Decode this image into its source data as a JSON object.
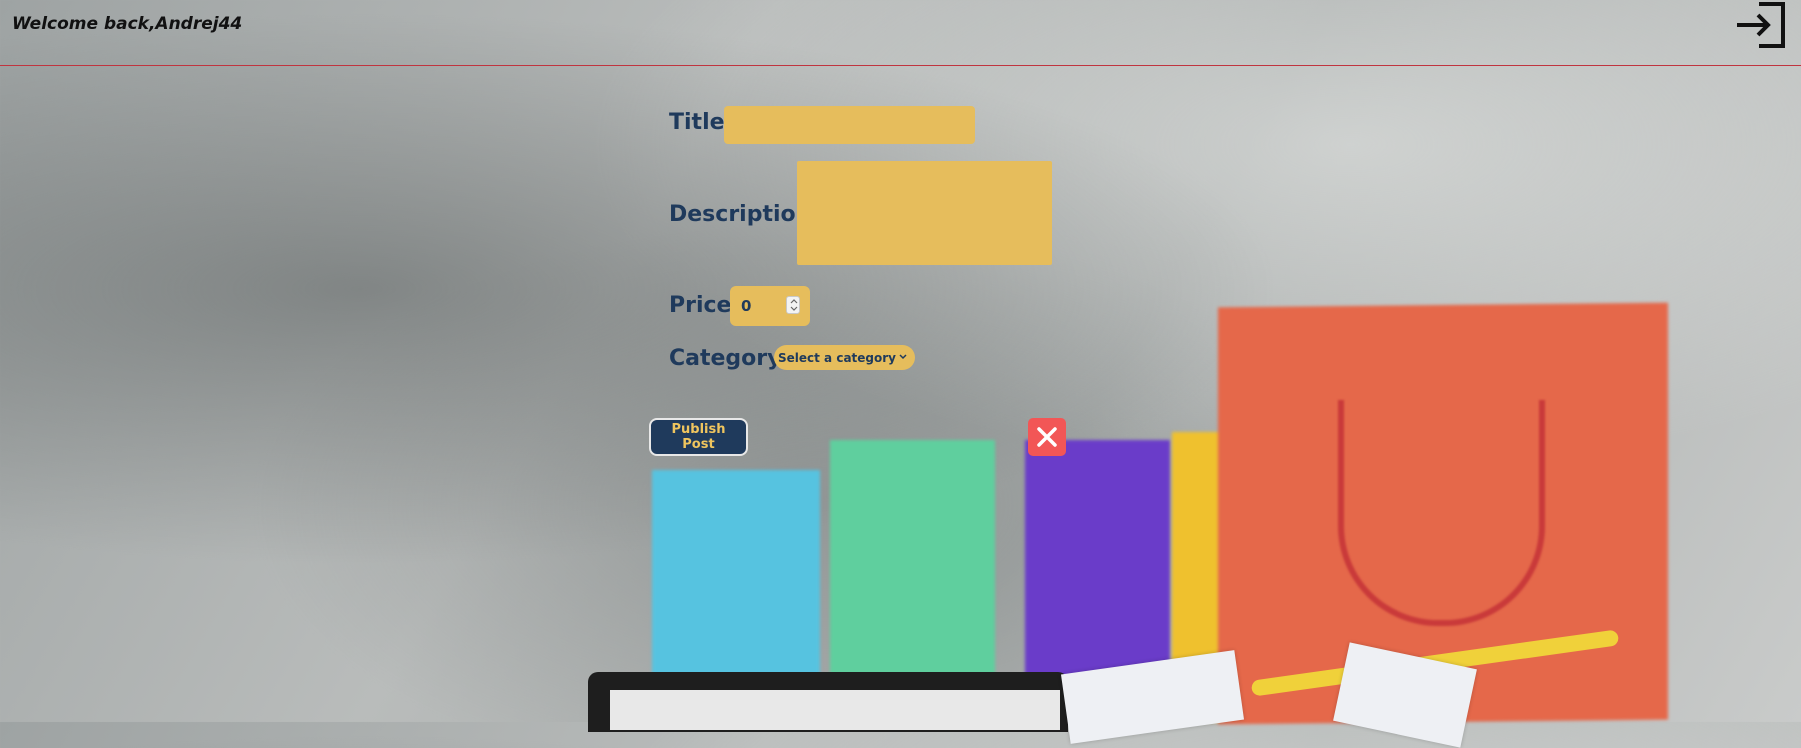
{
  "header": {
    "welcome_text": "Welcome back,Andrej44",
    "logout_icon": "sign-in-icon"
  },
  "form": {
    "title_label": "Title:",
    "title_value": "",
    "description_label": "Description:",
    "description_value": "",
    "price_label": "Price:",
    "price_value": "0",
    "category_label": "Category:",
    "category_selected": "Select a category",
    "publish_label": "Publish Post",
    "close_icon": "close-icon"
  },
  "colors": {
    "field_bg": "#e6bd5c",
    "label_text": "#1f3a5c",
    "publish_bg": "#1f3a5c",
    "publish_text": "#efc55e",
    "close_bg": "#f25656",
    "header_divider": "#c0343f"
  }
}
